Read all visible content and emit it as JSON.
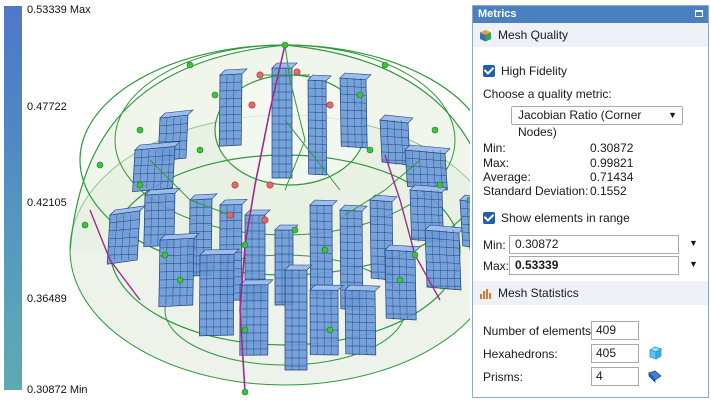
{
  "legend": {
    "max_label": "0.53339 Max",
    "ticks": [
      "0.47722",
      "0.42105",
      "0.36489"
    ],
    "min_label": "0.30872 Min",
    "gradient_top": "#4e78c8",
    "gradient_bottom": "#5fa9b2"
  },
  "viewport": {
    "element_color": "#6b9ad8",
    "element_edge": "#1d3f7a",
    "wire_color": "#2e9a3a",
    "node_green": "#3cc33c",
    "node_red": "#e06a6a",
    "edge_purple": "#a02a8f"
  },
  "panel": {
    "title": "Metrics",
    "mesh_quality_label": "Mesh Quality",
    "high_fidelity_label": "High Fidelity",
    "high_fidelity_checked": true,
    "choose_metric_label": "Choose a quality metric:",
    "metric_selected": "Jacobian Ratio (Corner Nodes)",
    "stats": [
      {
        "label": "Min:",
        "value": "0.30872"
      },
      {
        "label": "Max:",
        "value": "0.99821"
      },
      {
        "label": "Average:",
        "value": "0.71434"
      },
      {
        "label": "Standard Deviation:",
        "value": "0.1552"
      }
    ],
    "show_range_label": "Show elements in range",
    "show_range_checked": true,
    "range_min_label": "Min:",
    "range_min_value": "0.30872",
    "range_max_label": "Max:",
    "range_max_value": "0.53339",
    "mesh_statistics_label": "Mesh Statistics",
    "counts": [
      {
        "label": "Number of elements:",
        "value": "409"
      },
      {
        "label": "Hexahedrons:",
        "value": "405"
      },
      {
        "label": "Prisms:",
        "value": "4"
      }
    ],
    "accent": "#4a7fc0"
  }
}
